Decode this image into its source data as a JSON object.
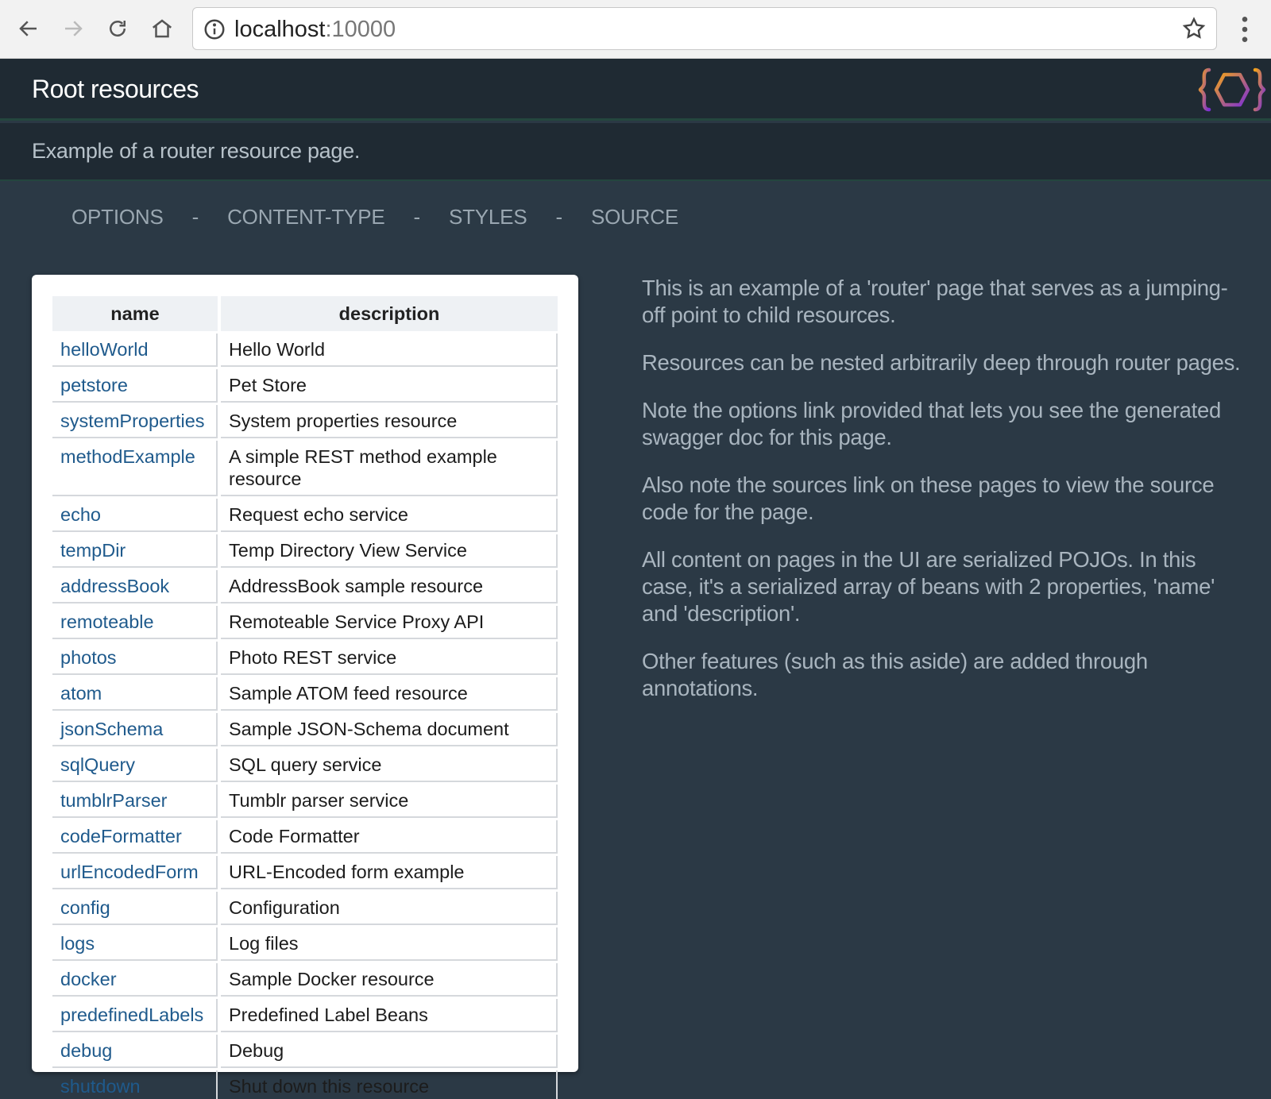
{
  "browser": {
    "url_host": "localhost",
    "url_port": ":10000",
    "icons": [
      "back-arrow-icon",
      "forward-arrow-icon",
      "reload-icon",
      "home-icon",
      "info-icon",
      "star-icon",
      "menu-dots-icon"
    ]
  },
  "header": {
    "title": "Root resources",
    "description": "Example of a router resource page."
  },
  "nav": {
    "links": [
      "OPTIONS",
      "CONTENT-TYPE",
      "STYLES",
      "SOURCE"
    ],
    "separator": "-"
  },
  "table": {
    "columns": [
      "name",
      "description"
    ],
    "rows": [
      {
        "name": "helloWorld",
        "description": "Hello World"
      },
      {
        "name": "petstore",
        "description": "Pet Store"
      },
      {
        "name": "systemProperties",
        "description": "System properties resource"
      },
      {
        "name": "methodExample",
        "description": "A simple REST method example resource"
      },
      {
        "name": "echo",
        "description": "Request echo service"
      },
      {
        "name": "tempDir",
        "description": "Temp Directory View Service"
      },
      {
        "name": "addressBook",
        "description": "AddressBook sample resource"
      },
      {
        "name": "remoteable",
        "description": "Remoteable Service Proxy API"
      },
      {
        "name": "photos",
        "description": "Photo REST service"
      },
      {
        "name": "atom",
        "description": "Sample ATOM feed resource"
      },
      {
        "name": "jsonSchema",
        "description": "Sample JSON-Schema document"
      },
      {
        "name": "sqlQuery",
        "description": "SQL query service"
      },
      {
        "name": "tumblrParser",
        "description": "Tumblr parser service"
      },
      {
        "name": "codeFormatter",
        "description": "Code Formatter"
      },
      {
        "name": "urlEncodedForm",
        "description": "URL-Encoded form example"
      },
      {
        "name": "config",
        "description": "Configuration"
      },
      {
        "name": "logs",
        "description": "Log files"
      },
      {
        "name": "docker",
        "description": "Sample Docker resource"
      },
      {
        "name": "predefinedLabels",
        "description": "Predefined Label Beans"
      },
      {
        "name": "debug",
        "description": "Debug"
      },
      {
        "name": "shutdown",
        "description": "Shut down this resource"
      }
    ]
  },
  "aside": {
    "paragraphs": [
      "This is an example of a 'router' page that serves as a jumping-off point to child resources.",
      "Resources can be nested arbitrarily deep through router pages.",
      "Note the options link provided that lets you see the generated swagger doc for this page.",
      "Also note the sources link on these pages to view the source code for the page.",
      "All content on pages in the UI are serialized POJOs. In this case, it's a serialized array of beans with 2 properties, 'name' and 'description'.",
      "Other features (such as this aside) are added through annotations."
    ]
  },
  "colors": {
    "header_bg": "#1f2a33",
    "page_bg": "#2b3945",
    "link": "#1f5a8c",
    "logo_orange": "#f2a21b",
    "logo_purple": "#7b2fd6"
  }
}
